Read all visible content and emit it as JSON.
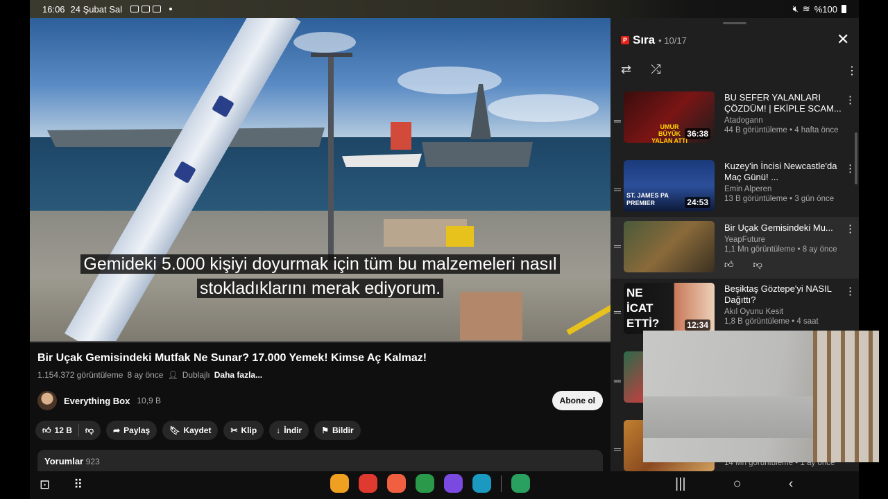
{
  "status_bar": {
    "time": "16:06",
    "date": "24 Şubat Sal",
    "battery": "%100"
  },
  "video": {
    "subtitle_line1": "Gemideki 5.000 kişiyi doyurmak için tüm bu malzemeleri nasıl",
    "subtitle_line2": "stokladıklarını merak ediyorum.",
    "title": "Bir Uçak Gemisindeki Mutfak Ne Sunar? 17.000 Yemek! Kimse Aç Kalmaz!",
    "views": "1.154.372 görüntüleme",
    "age": "8 ay önce",
    "dubbed": "Dublajlı",
    "more": "Daha fazla...",
    "channel": "Everything Box",
    "subs": "10,9 B",
    "subscribe": "Abone ol",
    "likes": "12 B",
    "share": "Paylaş",
    "save": "Kaydet",
    "clip": "Klip",
    "download": "İndir",
    "report": "Bildir",
    "comments_label": "Yorumlar",
    "comments_count": "923"
  },
  "queue": {
    "title": "Sıra",
    "position": "• 10/17",
    "items": [
      {
        "title": "BU SEFER YALANLARI ÇÖZDÜM! | EKİPLE SCAM...",
        "channel": "Atadogann",
        "stats": "44 B görüntüleme • 4 hafta önce",
        "duration": "36:38",
        "thumb_text": "UMUR BÜYÜK YALAN ATTI"
      },
      {
        "title": "Kuzey'in İncisi Newcastle'da Maç Günü! ...",
        "channel": "Emin Alperen",
        "stats": "13 B görüntüleme • 3 gün önce",
        "duration": "24:53",
        "thumb_text": "ST. JAMES PA PREMIER"
      },
      {
        "title": "Bir Uçak Gemisindeki Mu...",
        "channel": "YeapFuture",
        "stats": "1,1 Mn görüntüleme • 8 ay önce"
      },
      {
        "title": "Beşiktaş Göztepe'yi NASIL Dağıttı?",
        "channel": "Akıl Oyunu Kesit",
        "stats": "1,8 B görüntüleme • 4 saat",
        "duration": "12:34",
        "thumb_text": "NE İCAT ETTİ?"
      },
      {
        "stats": "14 Mn görüntüleme • 1 ay önce"
      }
    ]
  },
  "icons": {
    "menu": "more-vert-icon",
    "close": "close-icon",
    "repeat": "repeat-icon",
    "shuffle": "shuffle-icon"
  }
}
